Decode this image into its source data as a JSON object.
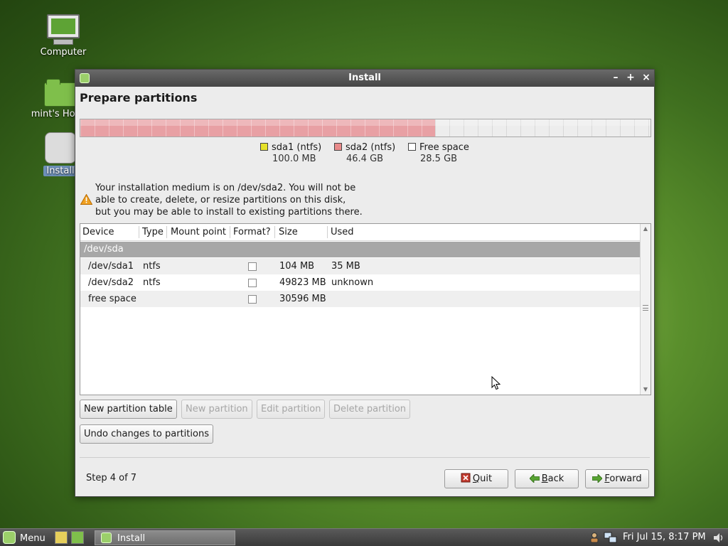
{
  "desktop": {
    "icons": [
      {
        "label": "Computer"
      },
      {
        "label": "mint's Home"
      },
      {
        "label": "Install"
      }
    ]
  },
  "window": {
    "title": "Install",
    "controls": {
      "minimize": "–",
      "maximize": "+",
      "close": "×"
    },
    "heading": "Prepare partitions",
    "partition_bar": {
      "used_fraction": 0.622,
      "used_color": "#e8a0a4",
      "free_color": "#ededed"
    },
    "legend": [
      {
        "name": "sda1 (ntfs)",
        "size": "100.0 MB",
        "color": "#e6e22a"
      },
      {
        "name": "sda2 (ntfs)",
        "size": "46.4 GB",
        "color": "#e88a8a"
      },
      {
        "name": "Free space",
        "size": "28.5 GB",
        "color": "#ffffff"
      }
    ],
    "warning": {
      "icon": "warning-icon",
      "line1": "Your installation medium is on /dev/sda2. You will not be",
      "line2": "able to create, delete, or resize partitions on this disk,",
      "line3": "but you may be able to install to existing partitions there."
    },
    "table": {
      "columns": [
        "Device",
        "Type",
        "Mount point",
        "Format?",
        "Size",
        "Used"
      ],
      "group": "/dev/sda",
      "rows": [
        {
          "device": "/dev/sda1",
          "type": "ntfs",
          "mount": "",
          "format": false,
          "size": "104 MB",
          "used": "35 MB"
        },
        {
          "device": "/dev/sda2",
          "type": "ntfs",
          "mount": "",
          "format": false,
          "size": "49823 MB",
          "used": "unknown"
        },
        {
          "device": "free space",
          "type": "",
          "mount": "",
          "format": false,
          "size": "30596 MB",
          "used": ""
        }
      ]
    },
    "buttons": {
      "new_table": "New partition table",
      "new_partition": "New partition",
      "edit_partition": "Edit partition",
      "delete_partition": "Delete partition",
      "undo": "Undo changes to partitions"
    },
    "footer": {
      "step": "Step 4 of 7",
      "quit": "Quit",
      "back": "Back",
      "forward": "Forward"
    }
  },
  "taskbar": {
    "menu": "Menu",
    "task": "Install",
    "clock": "Fri Jul 15,  8:17 PM"
  }
}
